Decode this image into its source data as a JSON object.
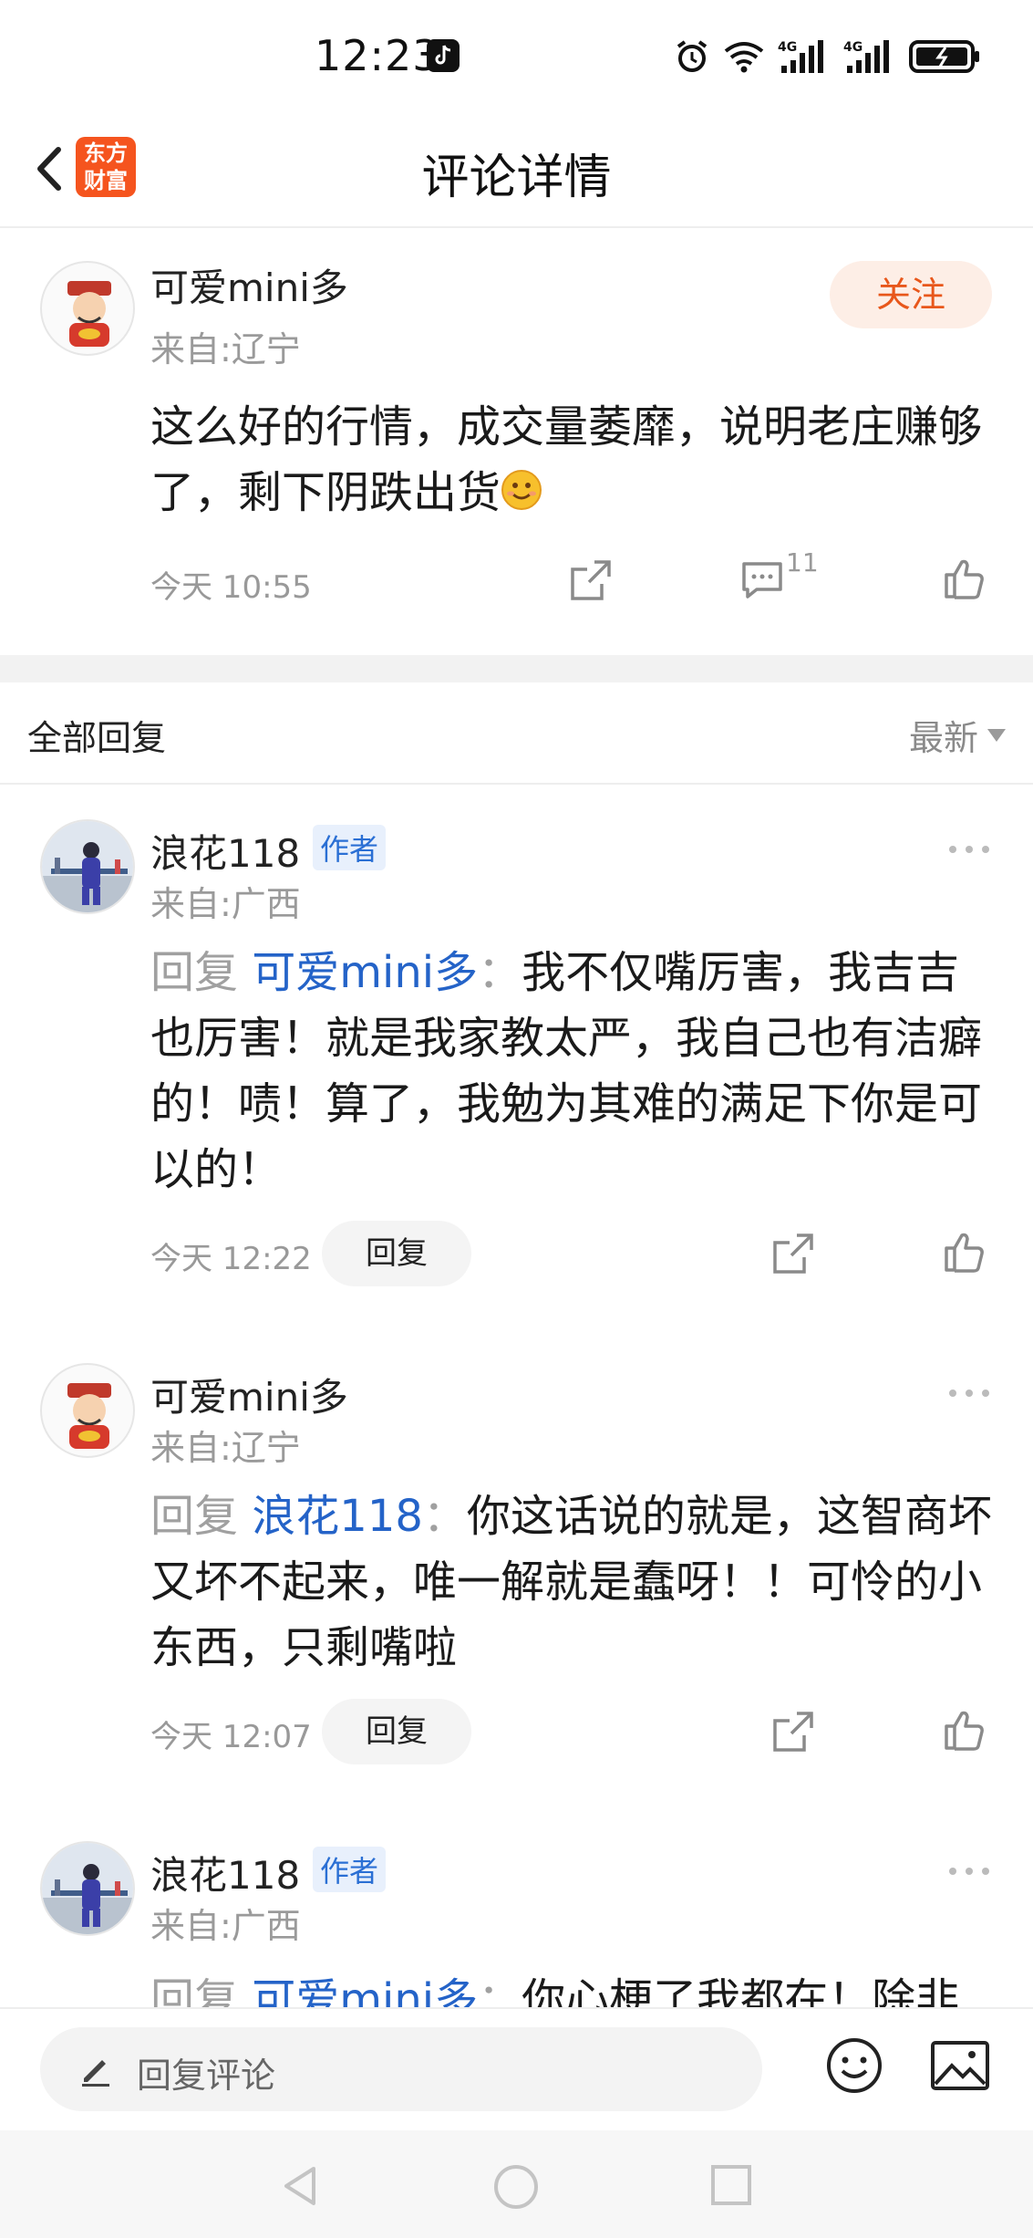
{
  "status_bar": {
    "time": "12:23",
    "network_1": "4G",
    "network_2": "4G"
  },
  "nav": {
    "title": "评论详情",
    "logo_line1": "东方",
    "logo_line2": "财富"
  },
  "main_comment": {
    "username": "可爱mini多",
    "location": "来自:辽宁",
    "follow_label": "关注",
    "text": "这么好的行情，成交量萎靡，说明老庄赚够了，剩下阴跌出货",
    "time": "今天 10:55",
    "reply_count": "11"
  },
  "replies_header": {
    "title": "全部回复",
    "sort_label": "最新"
  },
  "replies": [
    {
      "username": "浪花118",
      "badge": "作者",
      "location": "来自:广西",
      "prefix": "回复",
      "target": "可爱mini多",
      "colon": "：",
      "text": "我不仅嘴厉害，我吉吉也厉害！就是我家教太严，我自己也有洁癖的！啧！算了，我勉为其难的满足下你是可以的！",
      "time": "今天 12:22",
      "reply_label": "回复"
    },
    {
      "username": "可爱mini多",
      "badge": "",
      "location": "来自:辽宁",
      "prefix": "回复",
      "target": "浪花118",
      "colon": "：",
      "text": "你这话说的就是，这智商坏又坏不起来，唯一解就是蠢呀！！可怜的小东西，只剩嘴啦",
      "time": "今天 12:07",
      "reply_label": "回复"
    },
    {
      "username": "浪花118",
      "badge": "作者",
      "location": "来自:广西",
      "prefix": "回复",
      "target": "可爱mini多",
      "colon": "：",
      "text": "你心梗了我都在！除非"
    }
  ],
  "bottom_bar": {
    "input_label": "回复评论"
  },
  "colors": {
    "accent": "#e8571b",
    "link": "#2463c8",
    "muted": "#999999"
  }
}
